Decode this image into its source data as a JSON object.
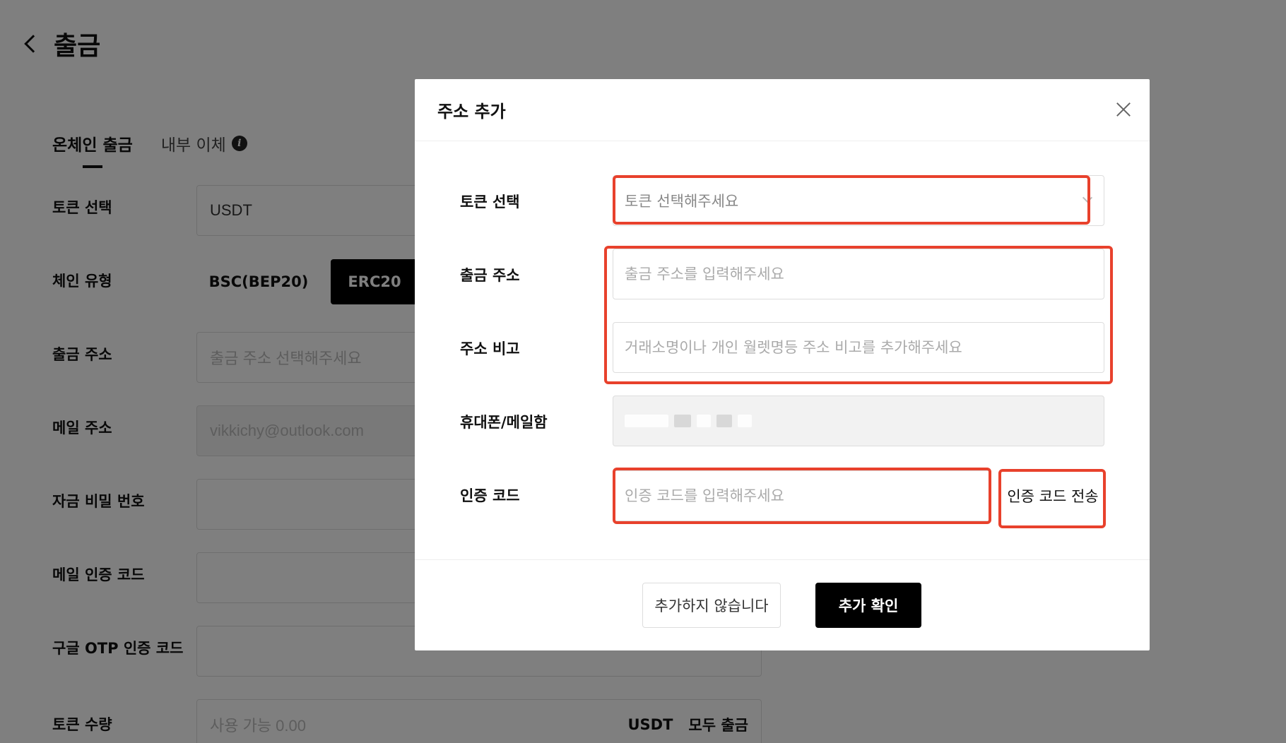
{
  "page": {
    "title": "출금",
    "tabs": [
      {
        "label": "온체인 출금"
      },
      {
        "label": "내부 이체"
      }
    ],
    "form": {
      "token_label": "토큰 선택",
      "token_value": "USDT",
      "chain_label": "체인 유형",
      "chain_options": [
        "BSC(BEP20)",
        "ERC20"
      ],
      "address_label": "출금 주소",
      "address_placeholder": "출금 주소 선택해주세요",
      "email_label": "메일 주소",
      "email_value": "vikkichy@outlook.com",
      "fund_password_label": "자금 비밀 번호",
      "email_code_label": "메일 인증 코드",
      "otp_label": "구글 OTP 인증 코드",
      "amount_label": "토큰 수량",
      "amount_placeholder": "사용 가능 0.00",
      "amount_unit": "USDT",
      "amount_all": "모두 출금"
    }
  },
  "modal": {
    "title": "주소 추가",
    "token_label": "토큰 선택",
    "token_placeholder": "토큰 선택해주세요",
    "address_label": "출금 주소",
    "address_placeholder": "출금 주소를 입력해주세요",
    "memo_label": "주소 비고",
    "memo_placeholder": "거래소명이나 개인 월렛명등 주소 비고를 추가해주세요",
    "contact_label": "휴대폰/메일함",
    "code_label": "인증 코드",
    "code_placeholder": "인증 코드를 입력해주세요",
    "send_code": "인증 코드 전송",
    "cancel": "추가하지 않습니다",
    "confirm": "추가 확인"
  },
  "colors": {
    "highlight": "#e8412c",
    "primary": "#000000",
    "overlay": "rgba(0,0,0,0.5)"
  }
}
